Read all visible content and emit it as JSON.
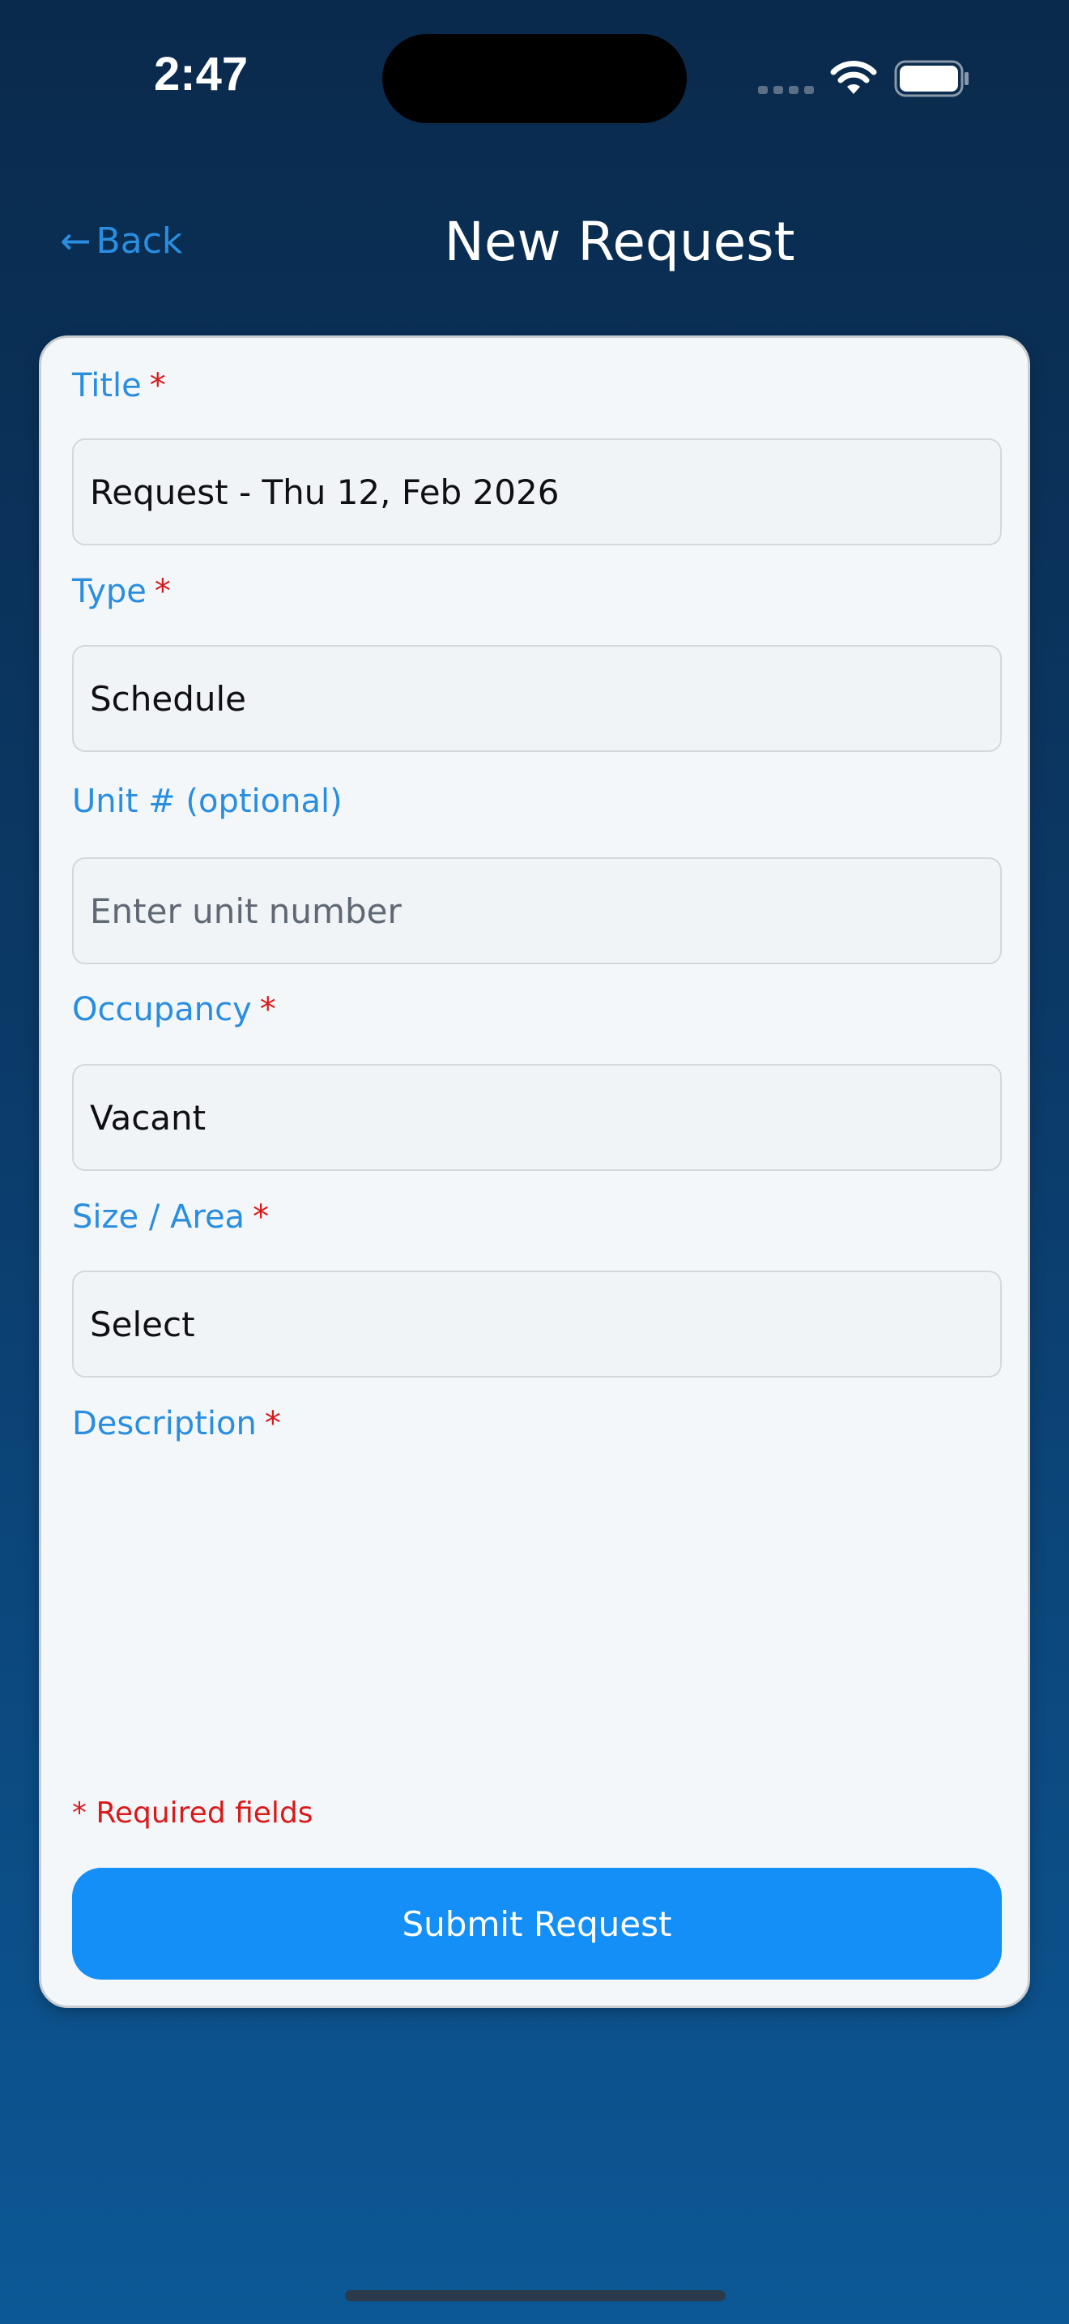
{
  "status_bar": {
    "time": "2:47",
    "icons": [
      "cellular-signal-icon",
      "wifi-icon",
      "battery-icon"
    ]
  },
  "nav": {
    "back_label": "Back",
    "back_icon": "arrow-left-icon",
    "title": "New Request"
  },
  "form": {
    "title": {
      "label": "Title",
      "required_mark": "*",
      "value": "Request - Thu 12, Feb 2026"
    },
    "type": {
      "label": "Type",
      "required_mark": "*",
      "value": "Schedule"
    },
    "unit": {
      "label": "Unit # (optional)",
      "placeholder": "Enter unit number"
    },
    "occupancy": {
      "label": "Occupancy",
      "required_mark": "*",
      "value": "Vacant"
    },
    "size_area": {
      "label": "Size / Area",
      "required_mark": "*",
      "value": "Select"
    },
    "description": {
      "label": "Description",
      "required_mark": "*"
    },
    "required_note": "* Required fields",
    "submit_label": "Submit Request"
  },
  "colors": {
    "accent": "#138ff7",
    "label": "#2a8ee0",
    "required": "#d91a1a",
    "background_top": "#0a2a4c",
    "background_bottom": "#0c5896"
  }
}
